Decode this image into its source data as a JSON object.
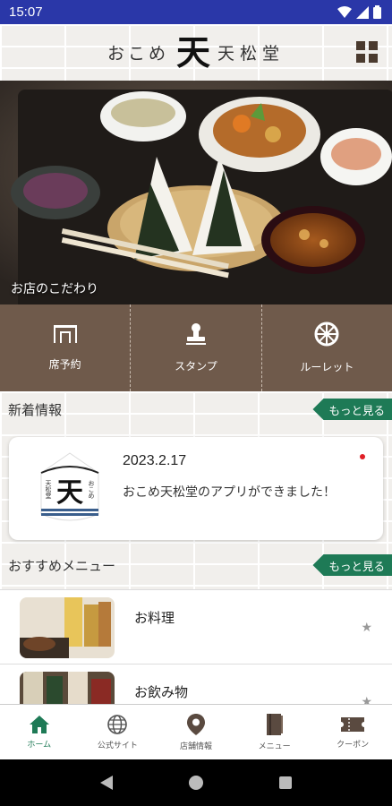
{
  "status_bar": {
    "time": "15:07"
  },
  "header": {
    "logo_kana": "おこめ",
    "logo_mark": "天",
    "logo_kanji": "天松堂"
  },
  "hero": {
    "caption": "お店のこだわり"
  },
  "actions": [
    {
      "label": "席予約",
      "icon": "reservation-icon"
    },
    {
      "label": "スタンプ",
      "icon": "stamp-icon"
    },
    {
      "label": "ルーレット",
      "icon": "roulette-icon"
    }
  ],
  "news": {
    "title": "新着情報",
    "more": "もっと見る",
    "items": [
      {
        "date": "2023.2.17",
        "text": "おこめ天松堂のアプリができました！",
        "logo_text_left": "天松堂",
        "logo_text_right": "おこめ",
        "logo_mark": "天"
      }
    ]
  },
  "recommend": {
    "title": "おすすめメニュー",
    "more": "もっと見る",
    "items": [
      {
        "label": "お料理"
      },
      {
        "label": "お飲み物"
      }
    ]
  },
  "tabs": [
    {
      "label": "ホーム",
      "icon": "home-icon",
      "active": true
    },
    {
      "label": "公式サイト",
      "icon": "globe-icon",
      "active": false
    },
    {
      "label": "店舗情報",
      "icon": "map-pin-icon",
      "active": false
    },
    {
      "label": "メニュー",
      "icon": "book-icon",
      "active": false
    },
    {
      "label": "クーポン",
      "icon": "coupon-icon",
      "active": false
    }
  ],
  "colors": {
    "status_bar": "#2a37a8",
    "accent_green": "#1e7a56",
    "tile_brown": "#6f5a4b",
    "new_dot": "#e01f26"
  }
}
